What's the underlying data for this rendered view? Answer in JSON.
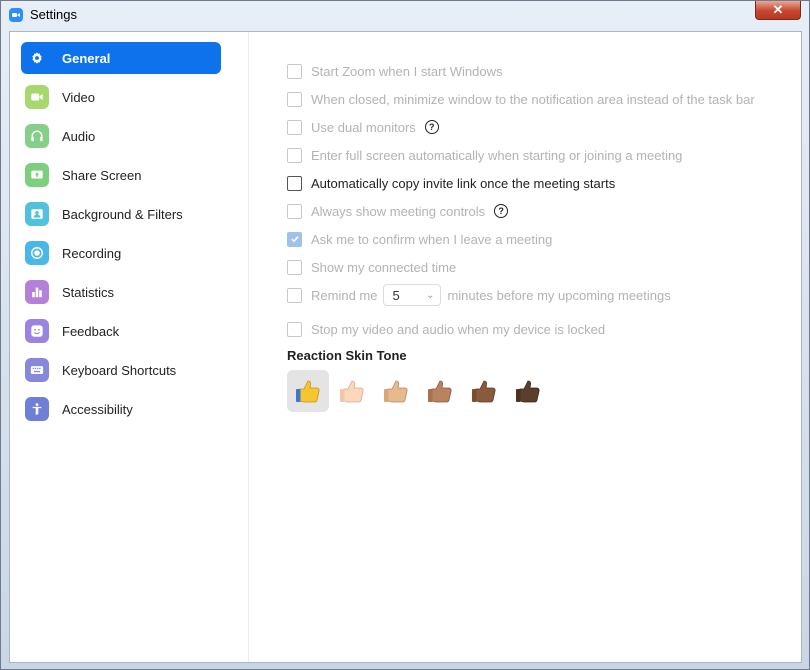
{
  "window": {
    "title": "Settings",
    "close_label": "✕"
  },
  "sidebar": {
    "items": [
      {
        "label": "General",
        "icon": "gear-icon",
        "color": "#ffffff",
        "active": true
      },
      {
        "label": "Video",
        "icon": "video-camera-icon",
        "color": "#a6d86e"
      },
      {
        "label": "Audio",
        "icon": "headphones-icon",
        "color": "#86cf8a"
      },
      {
        "label": "Share Screen",
        "icon": "share-screen-icon",
        "color": "#7ccf7d"
      },
      {
        "label": "Background & Filters",
        "icon": "background-icon",
        "color": "#52c1de"
      },
      {
        "label": "Recording",
        "icon": "record-icon",
        "color": "#49b8e6"
      },
      {
        "label": "Statistics",
        "icon": "chart-icon",
        "color": "#b580d8"
      },
      {
        "label": "Feedback",
        "icon": "smile-icon",
        "color": "#9b83e2"
      },
      {
        "label": "Keyboard Shortcuts",
        "icon": "keyboard-icon",
        "color": "#8688da"
      },
      {
        "label": "Accessibility",
        "icon": "accessibility-icon",
        "color": "#6f7fd6"
      }
    ]
  },
  "general": {
    "options": [
      {
        "label": "Start Zoom when I start Windows",
        "checked": false,
        "enabled": false
      },
      {
        "label": "When closed, minimize window to the notification area instead of the task bar",
        "checked": false,
        "enabled": false
      },
      {
        "label": "Use dual monitors",
        "checked": false,
        "enabled": false,
        "help": true
      },
      {
        "label": "Enter full screen automatically when starting or joining a meeting",
        "checked": false,
        "enabled": false
      },
      {
        "label": "Automatically copy invite link once the meeting starts",
        "checked": false,
        "enabled": true
      },
      {
        "label": "Always show meeting controls",
        "checked": false,
        "enabled": false,
        "help": true
      },
      {
        "label": "Ask me to confirm when I leave a meeting",
        "checked": true,
        "enabled": false
      },
      {
        "label": "Show my connected time",
        "checked": false,
        "enabled": false
      }
    ],
    "reminder": {
      "prefix": "Remind me",
      "value": "5",
      "suffix": "minutes before my upcoming meetings",
      "checked": false,
      "enabled": false
    },
    "lock_option": {
      "label": "Stop my video and audio when my device is locked",
      "checked": false,
      "enabled": false
    },
    "help_glyph": "?",
    "reaction": {
      "title": "Reaction Skin Tone",
      "tones": [
        {
          "name": "default",
          "color": "#f7c52f",
          "selected": true
        },
        {
          "name": "light",
          "color": "#fbd8bd"
        },
        {
          "name": "medium-light",
          "color": "#e7b98f"
        },
        {
          "name": "medium",
          "color": "#b98360"
        },
        {
          "name": "medium-dark",
          "color": "#8a5a3c"
        },
        {
          "name": "dark",
          "color": "#5b3e2b"
        }
      ]
    }
  },
  "colors": {
    "accent": "#0e72ed"
  }
}
